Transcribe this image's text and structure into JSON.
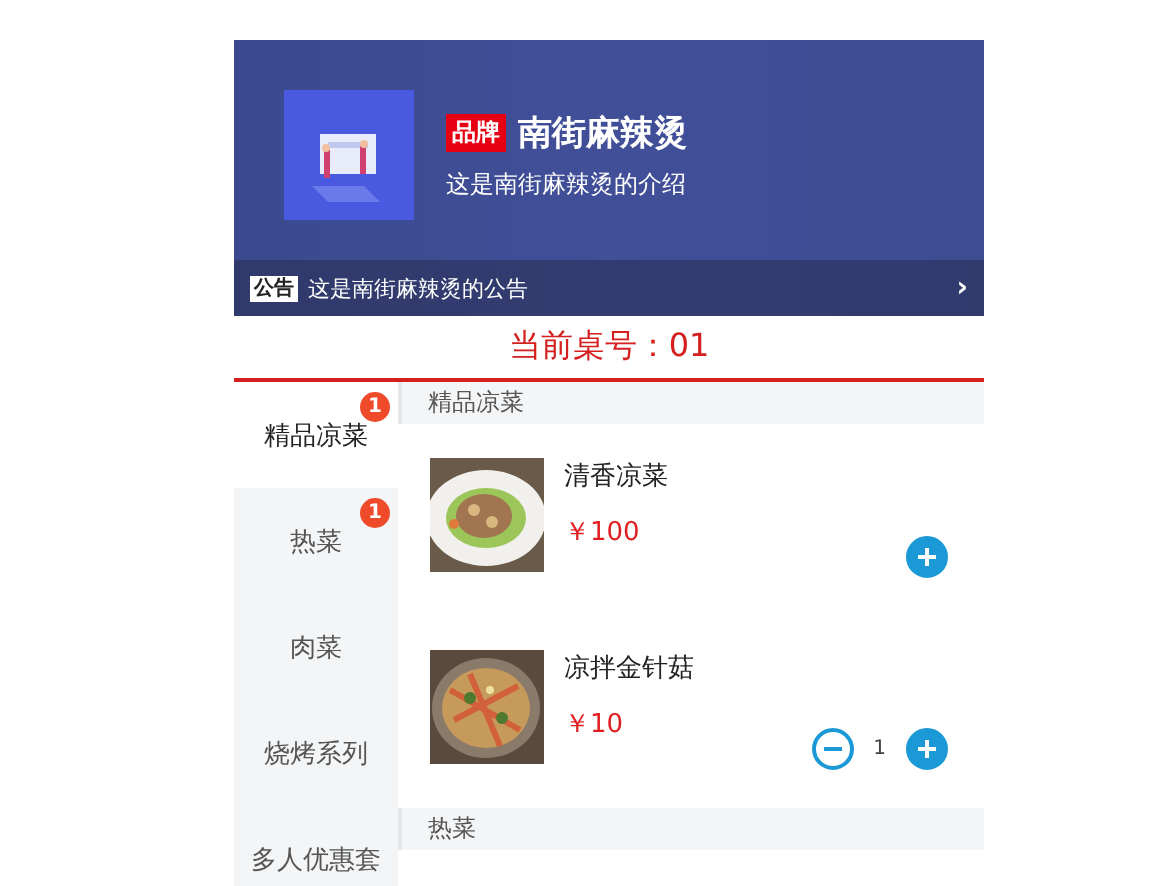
{
  "shop": {
    "brand_tag": "品牌",
    "name": "南街麻辣烫",
    "intro": "这是南街麻辣烫的介绍"
  },
  "notice": {
    "tag": "公告",
    "text": "这是南街麻辣烫的公告",
    "arrow": "›"
  },
  "table_number": "当前桌号：01",
  "categories": [
    {
      "label": "精品凉菜",
      "badge": "1",
      "selected": true
    },
    {
      "label": "热菜",
      "badge": "1",
      "selected": false
    },
    {
      "label": "肉菜",
      "selected": false
    },
    {
      "label": "烧烤系列",
      "selected": false
    },
    {
      "label": "多人优惠套",
      "selected": false
    }
  ],
  "sections": [
    {
      "title": "精品凉菜",
      "items": [
        {
          "name": "清香凉菜",
          "price": "￥100"
        },
        {
          "name": "凉拌金针菇",
          "price": "￥10",
          "quantity": "1"
        }
      ]
    },
    {
      "title": "热菜"
    }
  ]
}
